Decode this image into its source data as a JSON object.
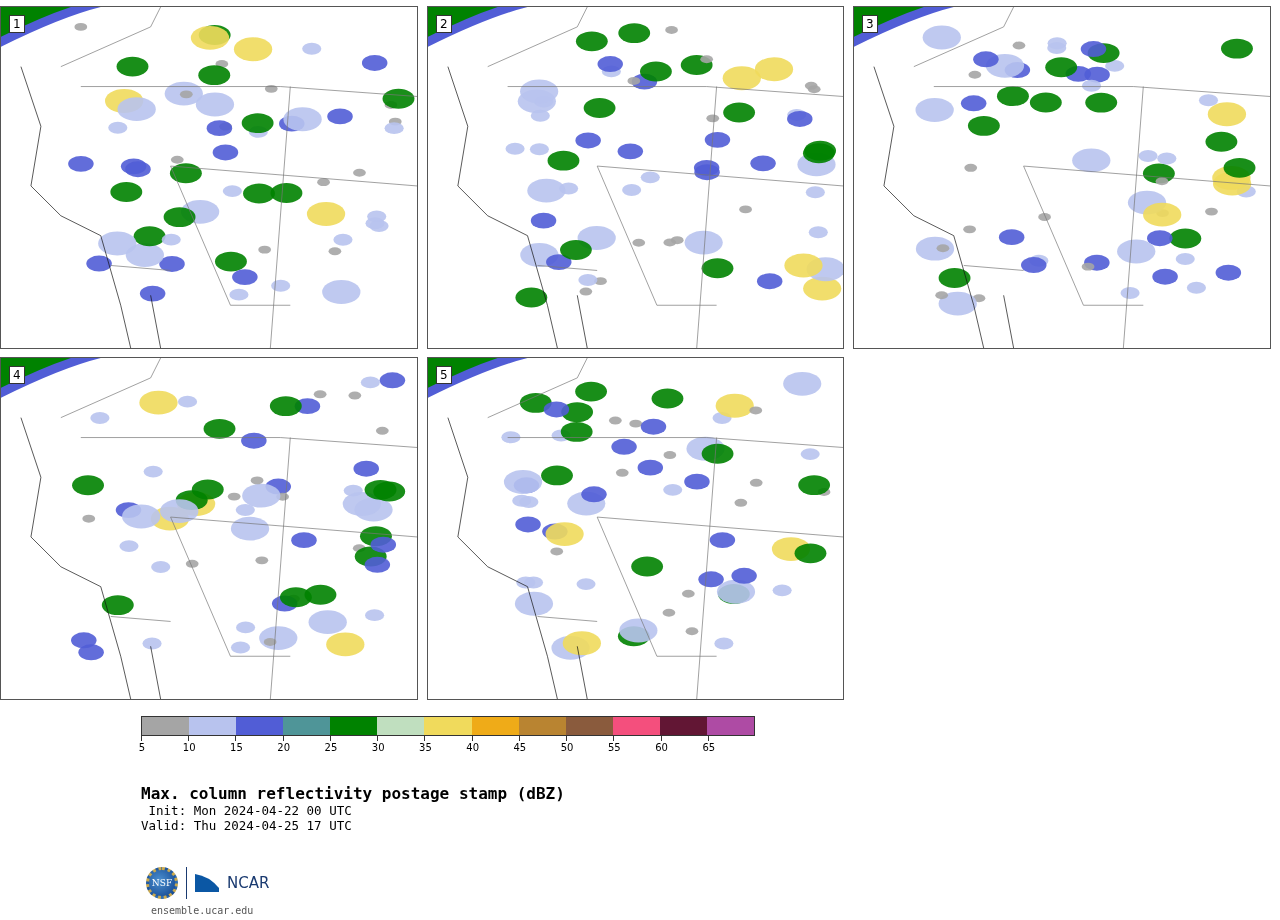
{
  "panels": [
    {
      "label": "1"
    },
    {
      "label": "2"
    },
    {
      "label": "3"
    },
    {
      "label": "4"
    },
    {
      "label": "5"
    }
  ],
  "colorbar": {
    "segments": [
      {
        "color": "#a5a5a5"
      },
      {
        "color": "#b8c3ee"
      },
      {
        "color": "#515dd6"
      },
      {
        "color": "#4f9598"
      },
      {
        "color": "#008200"
      },
      {
        "color": "#c0dfbf"
      },
      {
        "color": "#f0da5c"
      },
      {
        "color": "#efab18"
      },
      {
        "color": "#b98431"
      },
      {
        "color": "#8a5b3d"
      },
      {
        "color": "#f44f7d"
      },
      {
        "color": "#621634"
      },
      {
        "color": "#ae4ba4"
      }
    ],
    "ticks": [
      "5",
      "10",
      "15",
      "20",
      "25",
      "30",
      "35",
      "40",
      "45",
      "50",
      "55",
      "60",
      "65"
    ]
  },
  "title": "Max. column reflectivity postage stamp (dBZ)",
  "init": " Init: Mon 2024-04-22 00 UTC",
  "valid": "Valid: Thu 2024-04-25 17 UTC",
  "logo": {
    "seal": "NSF",
    "wordmark": "NCAR"
  },
  "url": "ensemble.ucar.edu"
}
